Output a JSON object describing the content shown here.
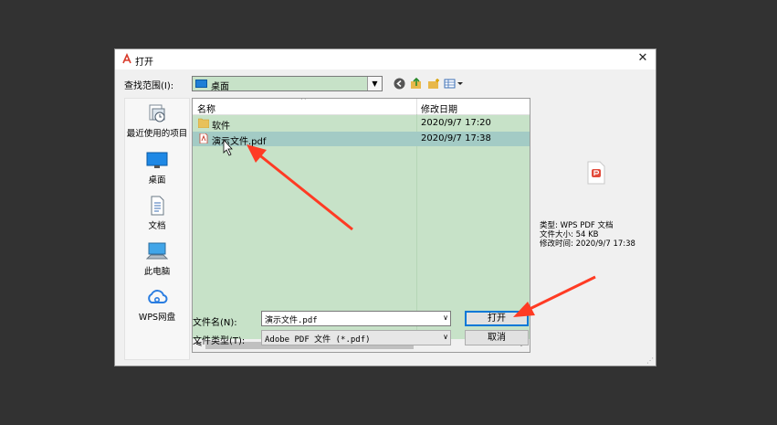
{
  "dialog": {
    "title": "打开",
    "look_in_label": "查找范围(I):",
    "look_in_value": "桌面",
    "places": [
      {
        "label": "最近使用的项目",
        "icon": "recent-items-icon"
      },
      {
        "label": "桌面",
        "icon": "desktop-icon"
      },
      {
        "label": "文档",
        "icon": "documents-icon"
      },
      {
        "label": "此电脑",
        "icon": "this-pc-icon"
      },
      {
        "label": "WPS网盘",
        "icon": "cloud-icon"
      }
    ],
    "columns": {
      "name": "名称",
      "date": "修改日期"
    },
    "files": [
      {
        "name": "软件",
        "date": "2020/9/7 17:20",
        "type": "folder",
        "selected": false
      },
      {
        "name": "演示文件.pdf",
        "date": "2020/9/7 17:38",
        "type": "pdf",
        "selected": true
      }
    ],
    "preview": {
      "type_line": "类型: WPS PDF 文档",
      "size_line": "文件大小: 54 KB",
      "modified_line": "修改时间: 2020/9/7 17:38"
    },
    "filename_label": "文件名(N):",
    "filename_value": "演示文件.pdf",
    "filetype_label": "文件类型(T):",
    "filetype_value": "Adobe PDF 文件 (*.pdf)",
    "open_button": "打开",
    "cancel_button": "取消"
  },
  "colors": {
    "background": "#323232",
    "list_bg": "#c7e2c8",
    "selected_row": "#a3cbc5",
    "arrow": "#ff3b24",
    "accent": "#0078d7"
  }
}
